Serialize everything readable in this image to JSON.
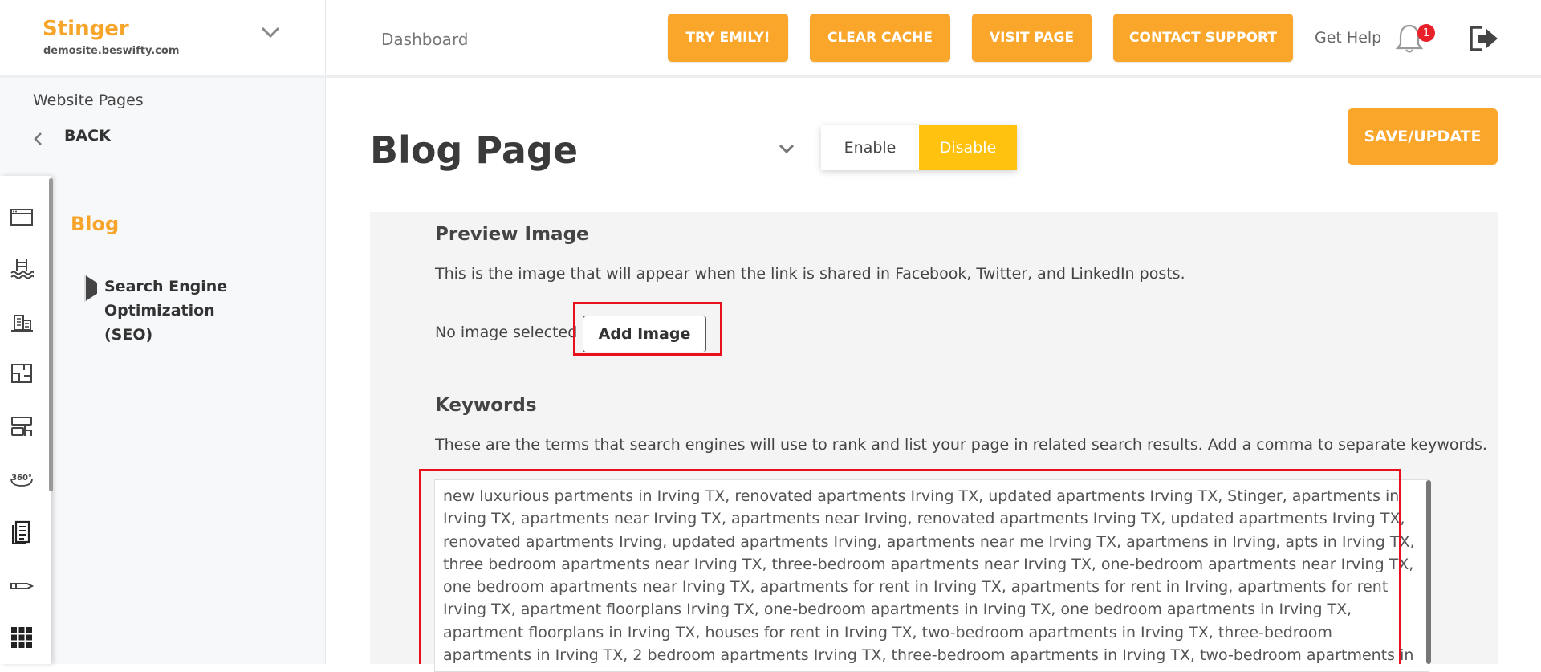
{
  "brand": {
    "name": "Stinger",
    "domain": "demosite.beswifty.com"
  },
  "header": {
    "breadcrumb": "Dashboard",
    "buttons": {
      "try_emily": "TRY EMILY!",
      "clear_cache": "CLEAR CACHE",
      "visit_page": "VISIT PAGE",
      "contact_support": "CONTACT SUPPORT"
    },
    "help_link": "Get Help",
    "notification_count": "1",
    "icons": [
      "chevron-down-icon",
      "bell-icon",
      "logout-icon"
    ]
  },
  "sidebar": {
    "section_title": "Website Pages",
    "back_label": "BACK",
    "nav_heading": "Blog",
    "nav_item": "Search Engine Optimization (SEO)",
    "rail_icons": [
      "browser-window-icon",
      "pool-icon",
      "building-icon",
      "floorplan-icon",
      "touch-sign-icon",
      "360-view-icon",
      "document-icon",
      "pen-icon",
      "grid-icon"
    ]
  },
  "main": {
    "page_title": "Blog Page",
    "toggle": {
      "enable": "Enable",
      "disable": "Disable",
      "selected": "Disable"
    },
    "save_label": "SAVE/UPDATE",
    "preview": {
      "title": "Preview Image",
      "description": "This is the image that will appear when the link is shared in Facebook, Twitter, and LinkedIn posts.",
      "status": "No image selected",
      "button": "Add Image"
    },
    "keywords": {
      "title": "Keywords",
      "description": "These are the terms that search engines will use to rank and list your page in related search results. Add a comma to separate keywords.",
      "value": "new luxurious partments in Irving TX, renovated apartments Irving TX, updated apartments Irving TX, Stinger, apartments in Irving TX, apartments near Irving TX, apartments near Irving, renovated apartments Irving TX, updated apartments Irving TX, renovated apartments Irving, updated apartments Irving, apartments near me Irving TX, apartmens in Irving, apts in Irving TX, three bedroom apartments near Irving TX, three-bedroom apartments near Irving TX, one-bedroom apartments near Irving TX, one bedroom apartments near Irving TX, apartments for rent in Irving TX, apartments for rent in Irving, apartments for rent Irving TX, apartment floorplans Irving TX, one-bedroom apartments in Irving TX, one bedroom apartments in Irving TX, apartment floorplans in Irving TX, houses for rent in Irving TX, two-bedroom apartments in Irving TX, three-bedroom apartments in Irving TX, 2 bedroom apartments Irving TX, three-bedroom apartments in Irving TX, two-bedroom apartments in Irving TX, two-bedroom apartments near Irving TX,"
    }
  },
  "colors": {
    "accent": "#f9a62b",
    "toggle_active": "#ffc20e",
    "highlight": "#e8101c",
    "badge": "#e8202a"
  }
}
